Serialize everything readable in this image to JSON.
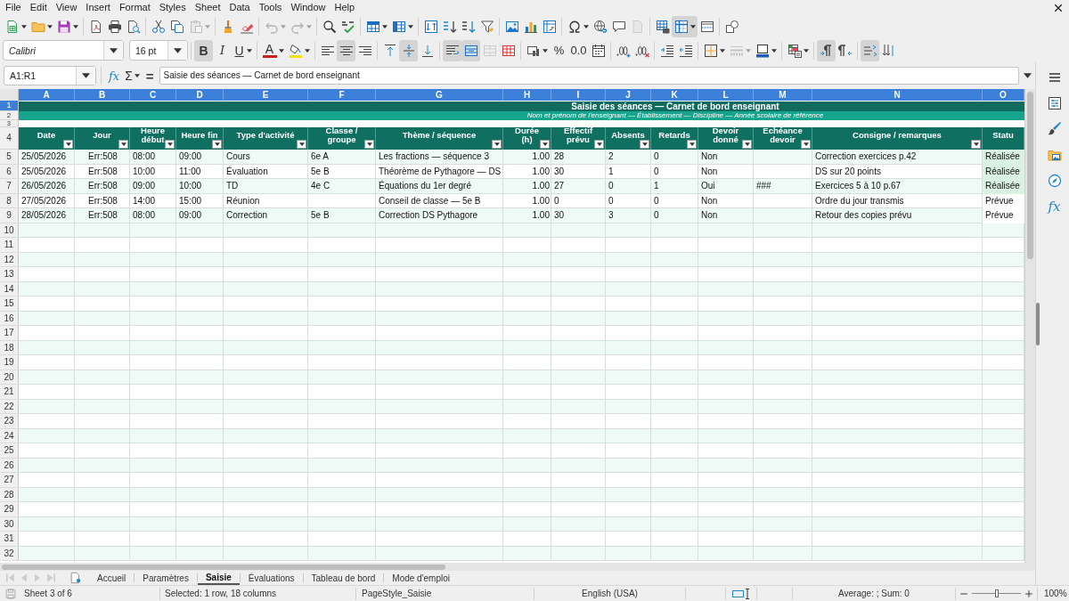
{
  "menu_bar": {
    "items": [
      "File",
      "Edit",
      "View",
      "Insert",
      "Format",
      "Styles",
      "Sheet",
      "Data",
      "Tools",
      "Window",
      "Help"
    ]
  },
  "standard_toolbar": [
    [
      {
        "pressed": false,
        "disabled": false
      },
      {
        "pressed": false,
        "disabled": false
      },
      {
        "pressed": false,
        "disabled": false
      }
    ],
    [
      {
        "pressed": false,
        "disabled": false
      },
      {
        "pressed": false,
        "disabled": false
      },
      {
        "pressed": false,
        "disabled": false
      }
    ],
    [
      {
        "pressed": false,
        "disabled": false
      },
      {
        "pressed": false,
        "disabled": false
      },
      {
        "pressed": false,
        "disabled": true
      }
    ],
    [
      {
        "pressed": false,
        "disabled": false
      },
      {
        "pressed": false,
        "disabled": false
      }
    ],
    [
      {
        "pressed": false,
        "disabled": true
      },
      {
        "pressed": false,
        "disabled": true
      }
    ],
    [
      {
        "pressed": false,
        "disabled": false
      },
      {
        "pressed": false,
        "disabled": false
      }
    ],
    [
      {
        "pressed": false,
        "disabled": false
      },
      {
        "pressed": false,
        "disabled": false
      }
    ],
    [
      {
        "pressed": false,
        "disabled": false
      },
      {
        "pressed": false,
        "disabled": false
      },
      {
        "pressed": false,
        "disabled": false
      },
      {
        "pressed": false,
        "disabled": false
      }
    ],
    [
      {
        "pressed": false,
        "disabled": false
      },
      {
        "pressed": false,
        "disabled": false
      },
      {
        "pressed": false,
        "disabled": false
      }
    ],
    [
      {
        "pressed": false,
        "disabled": false
      },
      {
        "pressed": false,
        "disabled": false
      },
      {
        "pressed": false,
        "disabled": false
      },
      {
        "pressed": false,
        "disabled": true
      }
    ],
    [
      {
        "pressed": false,
        "disabled": false
      },
      {
        "pressed": true,
        "disabled": false
      },
      {
        "pressed": false,
        "disabled": false
      }
    ],
    [
      {
        "pressed": false,
        "disabled": false
      }
    ]
  ],
  "formatting_toolbar": {
    "font_name": "Calibri",
    "font_size": "16 pt",
    "groups": [
      [
        {
          "label": "B",
          "pressed": true,
          "disabled": false
        },
        {
          "label": "I",
          "pressed": false,
          "disabled": false
        },
        {
          "label": "U",
          "pressed": false,
          "disabled": false
        }
      ],
      [
        {
          "label": "A",
          "pressed": false,
          "disabled": false
        },
        {
          "pressed": false,
          "disabled": false
        }
      ],
      [
        {
          "pressed": false,
          "disabled": false
        },
        {
          "pressed": true,
          "disabled": false
        },
        {
          "pressed": false,
          "disabled": false
        }
      ],
      [
        {
          "pressed": false,
          "disabled": false
        },
        {
          "pressed": true,
          "disabled": false
        },
        {
          "pressed": false,
          "disabled": false
        }
      ],
      [
        {
          "pressed": true,
          "disabled": false
        },
        {
          "pressed": true,
          "disabled": false
        },
        {
          "pressed": false,
          "disabled": true
        },
        {
          "pressed": false,
          "disabled": false
        }
      ],
      [
        {
          "pressed": false,
          "disabled": false
        },
        {
          "label": "%",
          "pressed": false,
          "disabled": false
        },
        {
          "label": "0.0",
          "pressed": false,
          "disabled": false
        },
        {
          "pressed": false,
          "disabled": false
        }
      ],
      [
        {
          "pressed": false,
          "disabled": false
        },
        {
          "pressed": false,
          "disabled": false
        }
      ],
      [
        {
          "pressed": false,
          "disabled": false
        },
        {
          "pressed": false,
          "disabled": false
        }
      ],
      [
        {
          "pressed": false,
          "disabled": false
        },
        {
          "pressed": false,
          "disabled": true
        },
        {
          "pressed": false,
          "disabled": false
        }
      ],
      [
        {
          "pressed": false,
          "disabled": false
        }
      ],
      [
        {
          "pressed": true,
          "disabled": false
        },
        {
          "pressed": false,
          "disabled": false
        }
      ],
      [
        {
          "pressed": true,
          "disabled": false
        },
        {
          "pressed": false,
          "disabled": false
        }
      ]
    ]
  },
  "formula_bar": {
    "name_box": "A1:R1",
    "function_wizard": "fx",
    "sum": "Σ",
    "formula": "=",
    "content": "Saisie des séances — Carnet de bord enseignant"
  },
  "sheet": {
    "title": "Saisie des séances — Carnet de bord enseignant",
    "subtitle": "Nom et prénom de l'enseignant — Établissement — Discipline — Année scolaire de référence",
    "columns": [
      {
        "letter": "A",
        "selected": true,
        "heading": "Date",
        "filter": true
      },
      {
        "letter": "B",
        "selected": true,
        "heading": "Jour",
        "filter": true
      },
      {
        "letter": "C",
        "selected": true,
        "heading": "Heure\ndébut",
        "filter": true
      },
      {
        "letter": "D",
        "selected": true,
        "heading": "Heure fin",
        "filter": true
      },
      {
        "letter": "E",
        "selected": true,
        "heading": "Type d'activité",
        "filter": true
      },
      {
        "letter": "F",
        "selected": true,
        "heading": "Classe /\ngroupe",
        "filter": true
      },
      {
        "letter": "G",
        "selected": true,
        "heading": "Thème / séquence",
        "filter": true
      },
      {
        "letter": "H",
        "selected": true,
        "heading": "Durée\n(h)",
        "filter": true
      },
      {
        "letter": "I",
        "selected": true,
        "heading": "Effectif\nprévu",
        "filter": true
      },
      {
        "letter": "J",
        "selected": true,
        "heading": "Absents",
        "filter": true
      },
      {
        "letter": "K",
        "selected": true,
        "heading": "Retards",
        "filter": true
      },
      {
        "letter": "L",
        "selected": true,
        "heading": "Devoir\ndonné",
        "filter": true
      },
      {
        "letter": "M",
        "selected": true,
        "heading": "Échéance\ndevoir",
        "filter": true
      },
      {
        "letter": "N",
        "selected": true,
        "heading": "Consigne / remarques",
        "filter": true
      },
      {
        "letter": "O",
        "selected": true,
        "heading": "Statu",
        "filter": false
      }
    ],
    "row_headers": [
      {
        "number": "1",
        "selected": true
      },
      {
        "number": "2",
        "selected": false
      },
      {
        "number": "3",
        "selected": false
      },
      {
        "number": "4",
        "selected": false
      },
      {
        "number": "5",
        "selected": false
      },
      {
        "number": "6",
        "selected": false
      },
      {
        "number": "7",
        "selected": false
      },
      {
        "number": "8",
        "selected": false
      },
      {
        "number": "9",
        "selected": false
      },
      {
        "number": "10",
        "selected": false
      },
      {
        "number": "11",
        "selected": false
      },
      {
        "number": "12",
        "selected": false
      },
      {
        "number": "13",
        "selected": false
      },
      {
        "number": "14",
        "selected": false
      },
      {
        "number": "15",
        "selected": false
      },
      {
        "number": "16",
        "selected": false
      },
      {
        "number": "17",
        "selected": false
      },
      {
        "number": "18",
        "selected": false
      },
      {
        "number": "19",
        "selected": false
      },
      {
        "number": "20",
        "selected": false
      },
      {
        "number": "21",
        "selected": false
      },
      {
        "number": "22",
        "selected": false
      },
      {
        "number": "23",
        "selected": false
      },
      {
        "number": "24",
        "selected": false
      },
      {
        "number": "25",
        "selected": false
      },
      {
        "number": "26",
        "selected": false
      },
      {
        "number": "27",
        "selected": false
      },
      {
        "number": "28",
        "selected": false
      },
      {
        "number": "29",
        "selected": false
      },
      {
        "number": "30",
        "selected": false
      },
      {
        "number": "31",
        "selected": false
      },
      {
        "number": "32",
        "selected": false
      }
    ],
    "rows": [
      {
        "cells": {
          "A": "25/05/2026",
          "B": "Err:508",
          "C": "08:00",
          "D": "09:00",
          "E": "Cours",
          "F": "6e A",
          "G": "Les fractions — séquence 3",
          "H": "1.00",
          "I": "28",
          "J": "2",
          "K": "0",
          "L": "Non",
          "N": "Correction exercices p.42",
          "O": "Réalisée"
        },
        "color": "#d9f2e2"
      },
      {
        "cells": {
          "A": "25/05/2026",
          "B": "Err:508",
          "C": "10:00",
          "D": "11:00",
          "E": "Évaluation",
          "F": "5e B",
          "G": "Théorème de Pythagore — DS",
          "H": "1.00",
          "I": "30",
          "J": "1",
          "K": "0",
          "L": "Non",
          "N": "DS sur 20 points",
          "O": "Réalisée"
        },
        "color": "#d9f2e2"
      },
      {
        "cells": {
          "A": "26/05/2026",
          "B": "Err:508",
          "C": "09:00",
          "D": "10:00",
          "E": "TD",
          "F": "4e C",
          "G": "Équations du 1er degré",
          "H": "1.00",
          "I": "27",
          "J": "0",
          "K": "1",
          "L": "Oui",
          "M": "###",
          "N": "Exercices 5 à 10 p.67",
          "O": "Réalisée"
        },
        "color": "#d9f2e2"
      },
      {
        "cells": {
          "A": "27/05/2026",
          "B": "Err:508",
          "C": "14:00",
          "D": "15:00",
          "E": "Réunion",
          "G": "Conseil de classe — 5e B",
          "H": "1.00",
          "I": "0",
          "J": "0",
          "K": "0",
          "L": "Non",
          "N": "Ordre du jour transmis",
          "O": "Prévue"
        },
        "color": "#ffffff"
      },
      {
        "cells": {
          "A": "28/05/2026",
          "B": "Err:508",
          "C": "08:00",
          "D": "09:00",
          "E": "Correction",
          "F": "5e B",
          "G": "Correction DS Pythagore",
          "H": "1.00",
          "I": "30",
          "J": "3",
          "K": "0",
          "L": "Non",
          "N": "Retour des copies prévu",
          "O": "Prévue"
        },
        "color": "#ffffff"
      }
    ]
  },
  "sheet_tabs": [
    {
      "label": "Accueil",
      "selected": false
    },
    {
      "label": "Paramètres",
      "selected": false
    },
    {
      "label": "Saisie",
      "selected": true
    },
    {
      "label": "Évaluations",
      "selected": false
    },
    {
      "label": "Tableau de bord",
      "selected": false
    },
    {
      "label": "Mode d'emploi",
      "selected": false
    }
  ],
  "sidebar": {
    "functions_tab": "fx"
  },
  "status_bar": {
    "sheet_position": "Sheet 3 of 6",
    "selection": "Selected: 1 row, 18 columns",
    "page_style": "PageStyle_Saisie",
    "language": "English (USA)",
    "summary": "Average: ; Sum: 0",
    "zoom": {
      "level": 0.5,
      "reading": "100%"
    }
  }
}
